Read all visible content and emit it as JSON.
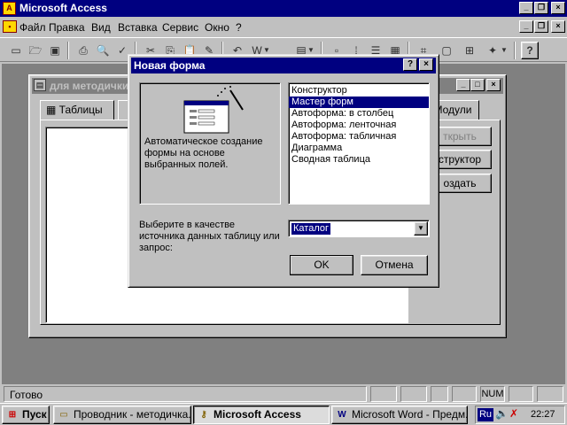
{
  "app": {
    "title": "Microsoft Access",
    "menu": [
      "Файл",
      "Правка",
      "Вид",
      "Вставка",
      "Сервис",
      "Окно",
      "?"
    ]
  },
  "db_window": {
    "title": "для методички",
    "tabs": [
      "Таблицы",
      "Модули"
    ],
    "buttons": [
      "Открыть",
      "Конструктор",
      "Создать"
    ],
    "visible_button_text": [
      "ткрыть",
      "структор",
      "оздать"
    ]
  },
  "dialog": {
    "title": "Новая форма",
    "help_btn": "?",
    "close_btn": "×",
    "description": "Автоматическое создание формы на основе выбранных полей.",
    "form_types": [
      "Конструктор",
      "Мастер форм",
      "Автоформа: в столбец",
      "Автоформа: ленточная",
      "Автоформа: табличная",
      "Диаграмма",
      "Сводная таблица"
    ],
    "selected_index": 1,
    "source_label": "Выберите в качестве источника данных таблицу или запрос:",
    "source_value": "Каталог",
    "ok": "OK",
    "cancel": "Отмена"
  },
  "status": {
    "text": "Готово",
    "num": "NUM"
  },
  "taskbar": {
    "start": "Пуск",
    "tasks": [
      "Проводник - методичка...",
      "Microsoft Access",
      "Microsoft Word - Предм..."
    ],
    "lang": "Ru",
    "time": "22:27"
  }
}
